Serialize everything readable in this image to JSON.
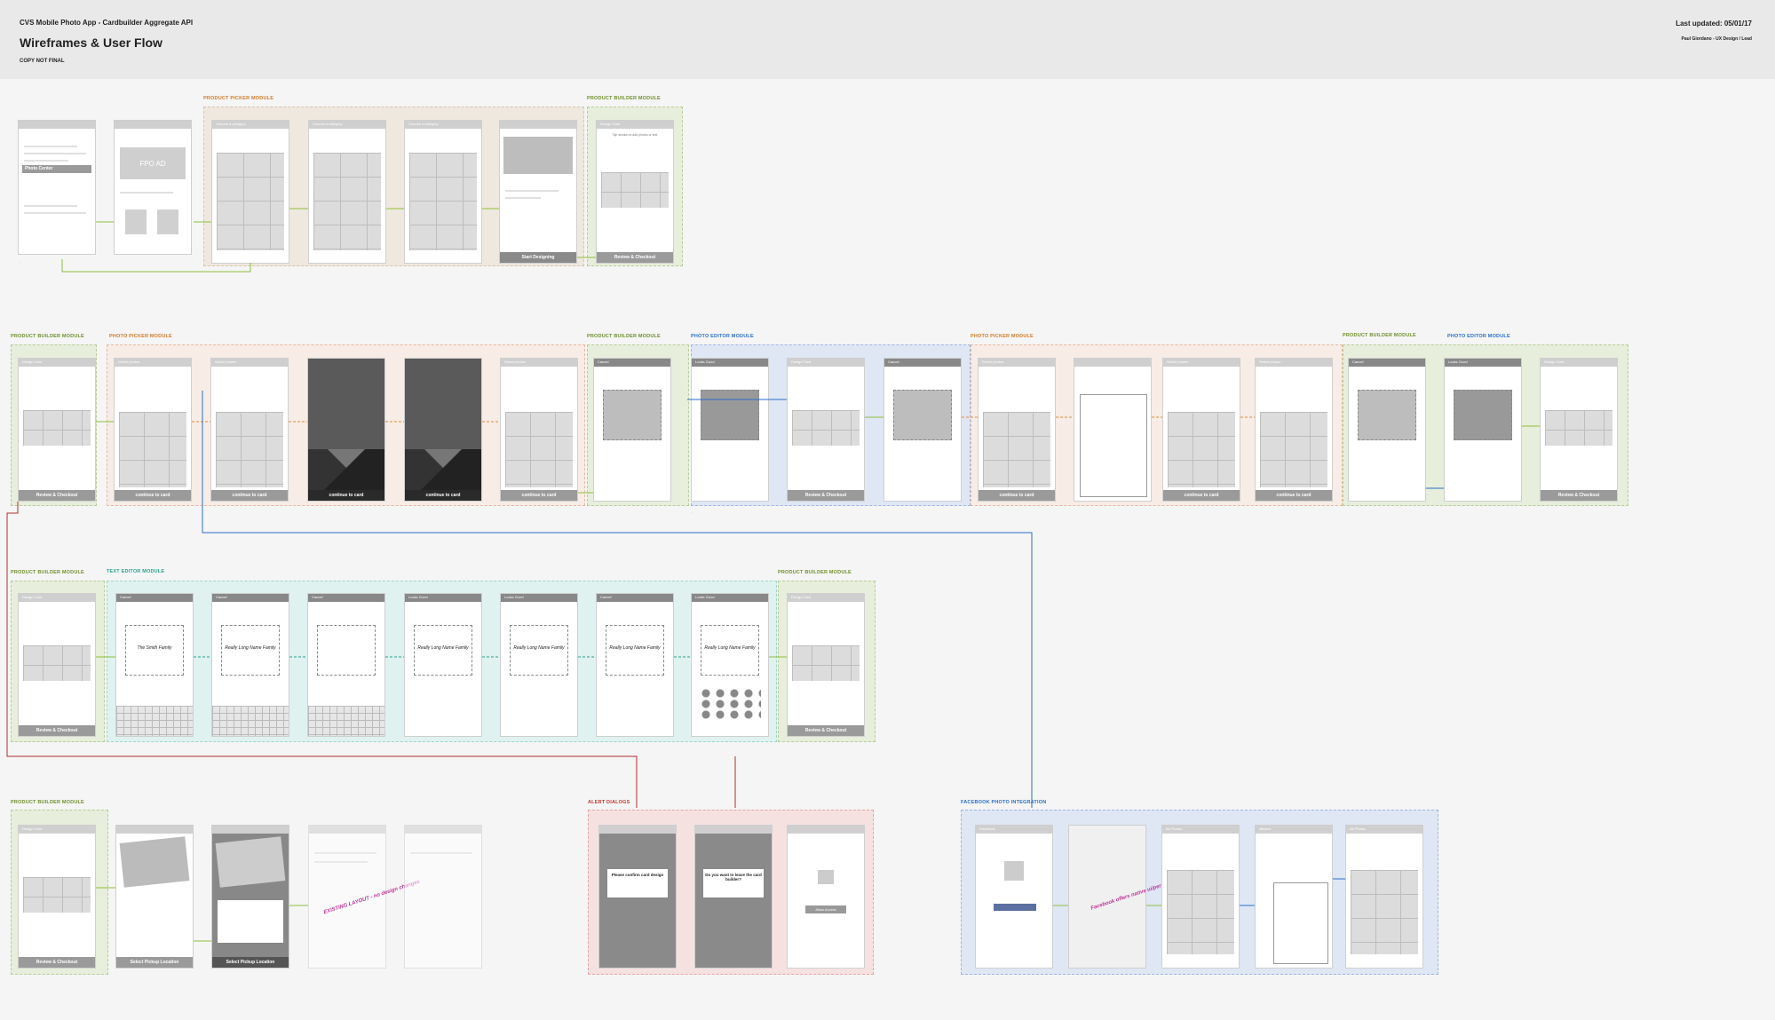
{
  "header": {
    "subtitle": "CVS Mobile Photo App - Cardbuilder Aggregate API",
    "title": "Wireframes & User Flow",
    "note": "COPY NOT FINAL",
    "updated": "Last updated:  05/01/17",
    "author": "Paul Giordano - UX Design / Lead"
  },
  "modules": {
    "product_picker": "PRODUCT PICKER MODULE",
    "product_builder": "PRODUCT BUILDER MODULE",
    "photo_picker": "PHOTO PICKER MODULE",
    "photo_editor": "PHOTO EDITOR MODULE",
    "text_editor": "TEXT EDITOR MODULE",
    "alert_dialogs": "ALERT DIALOGS",
    "facebook": "FACEBOOK PHOTO INTEGRATION"
  },
  "screens": {
    "home_bar": "Photo Center",
    "fpo": "FPO AD",
    "design_card": "Design Card",
    "choose_category": "Choose a category",
    "select_photos": "Select photos",
    "start_designing": "Start Designing",
    "review_checkout": "Review & Checkout",
    "continue_to_card": "continue to card",
    "cancel": "Cancel",
    "looks_good": "Looks Good",
    "tap_section": "Tap section to add photos or text",
    "select_pickup": "Select Pickup Location",
    "smith_family": "The Smith Family",
    "long_family": "Really Long Name Family",
    "confirm_dialog": "Please confirm card design",
    "leave_dialog": "Do you want to leave the card builder?",
    "all_photos": "All Photos",
    "albums": "Albums",
    "facebook_tab": "Facebook",
    "allow_access": "Allow Access"
  },
  "annotations": {
    "existing_layout": "EXISTING LAYOUT - no design changes",
    "fb_note": "Facebook offers native ui/permissions"
  }
}
